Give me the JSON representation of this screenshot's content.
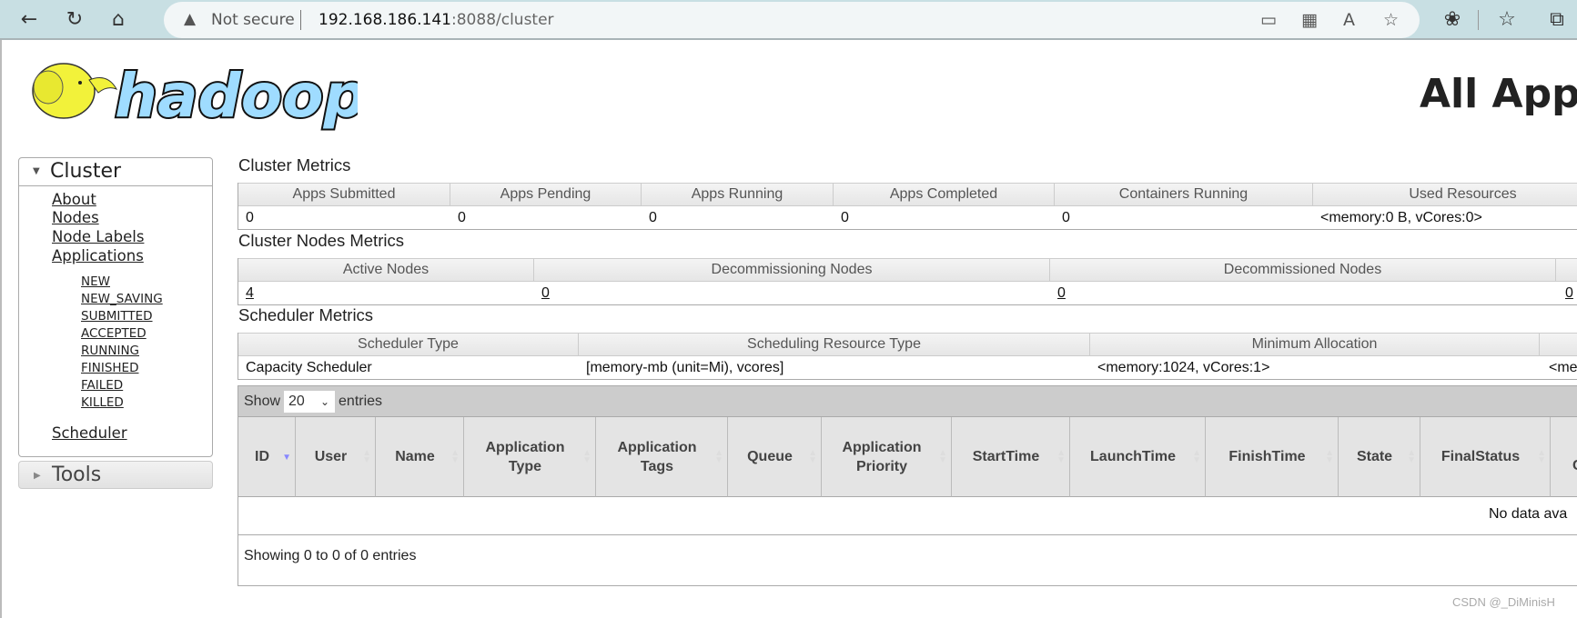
{
  "browser": {
    "security": "Not secure",
    "url_host": "192.168.186.141",
    "url_rest": ":8088/cluster"
  },
  "logo": {
    "text": "hadoop"
  },
  "page_title": "All Appl",
  "sidebar": {
    "cluster_label": "Cluster",
    "links": [
      "About",
      "Nodes",
      "Node Labels",
      "Applications"
    ],
    "app_states": [
      "NEW",
      "NEW_SAVING",
      "SUBMITTED",
      "ACCEPTED",
      "RUNNING",
      "FINISHED",
      "FAILED",
      "KILLED"
    ],
    "scheduler": "Scheduler",
    "tools_label": "Tools"
  },
  "cluster_metrics": {
    "title": "Cluster Metrics",
    "headers": [
      "Apps Submitted",
      "Apps Pending",
      "Apps Running",
      "Apps Completed",
      "Containers Running",
      "Used Resources"
    ],
    "values": [
      "0",
      "0",
      "0",
      "0",
      "0",
      "<memory:0 B, vCores:0>"
    ]
  },
  "nodes_metrics": {
    "title": "Cluster Nodes Metrics",
    "headers": [
      "Active Nodes",
      "Decommissioning Nodes",
      "Decommissioned Nodes"
    ],
    "values": [
      "4",
      "0",
      "0",
      "0"
    ]
  },
  "scheduler_metrics": {
    "title": "Scheduler Metrics",
    "headers": [
      "Scheduler Type",
      "Scheduling Resource Type",
      "Minimum Allocation"
    ],
    "values": [
      "Capacity Scheduler",
      "[memory-mb (unit=Mi), vcores]",
      "<memory:1024, vCores:1>",
      "<me"
    ]
  },
  "apps_table": {
    "show": "Show",
    "page_size": "20",
    "entries": "entries",
    "columns": [
      "ID",
      "User",
      "Name",
      "Application Type",
      "Application Tags",
      "Queue",
      "Application Priority",
      "StartTime",
      "LaunchTime",
      "FinishTime",
      "State",
      "FinalStatus",
      "C"
    ],
    "empty_text": "No data ava",
    "footer": "Showing 0 to 0 of 0 entries"
  },
  "watermark": "CSDN @_DiMinisH"
}
